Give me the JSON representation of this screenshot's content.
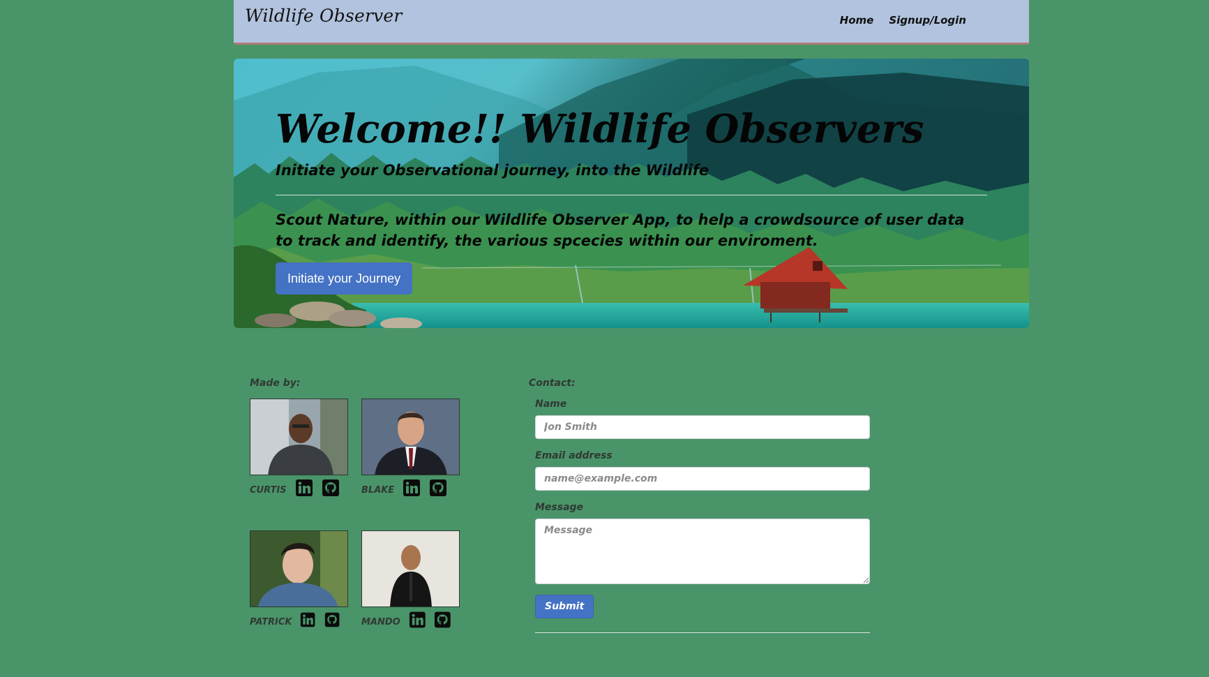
{
  "navbar": {
    "brand": "Wildlife Observer",
    "links": [
      "Home",
      "Signup/Login"
    ]
  },
  "hero": {
    "title": "Welcome!! Wildlife Observers",
    "subtitle": "Initiate your Observational journey, into the Wildlife",
    "description": "Scout Nature, within our Wildlife Observer App, to help a crowdsource of user data to track and identify, the various spcecies within our enviroment.",
    "button_label": "Initiate your Journey"
  },
  "team": {
    "label": "Made by:",
    "members": [
      {
        "name": "CURTIS"
      },
      {
        "name": "BLAKE"
      },
      {
        "name": "PATRICK"
      },
      {
        "name": "MANDO"
      }
    ]
  },
  "contact": {
    "label": "Contact:",
    "name_label": "Name",
    "name_placeholder": "Jon Smith",
    "email_label": "Email address",
    "email_placeholder": "name@example.com",
    "message_label": "Message",
    "message_placeholder": "Message",
    "submit_label": "Submit"
  },
  "colors": {
    "page_bg": "#4a9469",
    "navbar_bg": "#b1c3de",
    "accent_button": "#4472c4"
  },
  "icons": [
    "linkedin-icon",
    "github-icon"
  ]
}
